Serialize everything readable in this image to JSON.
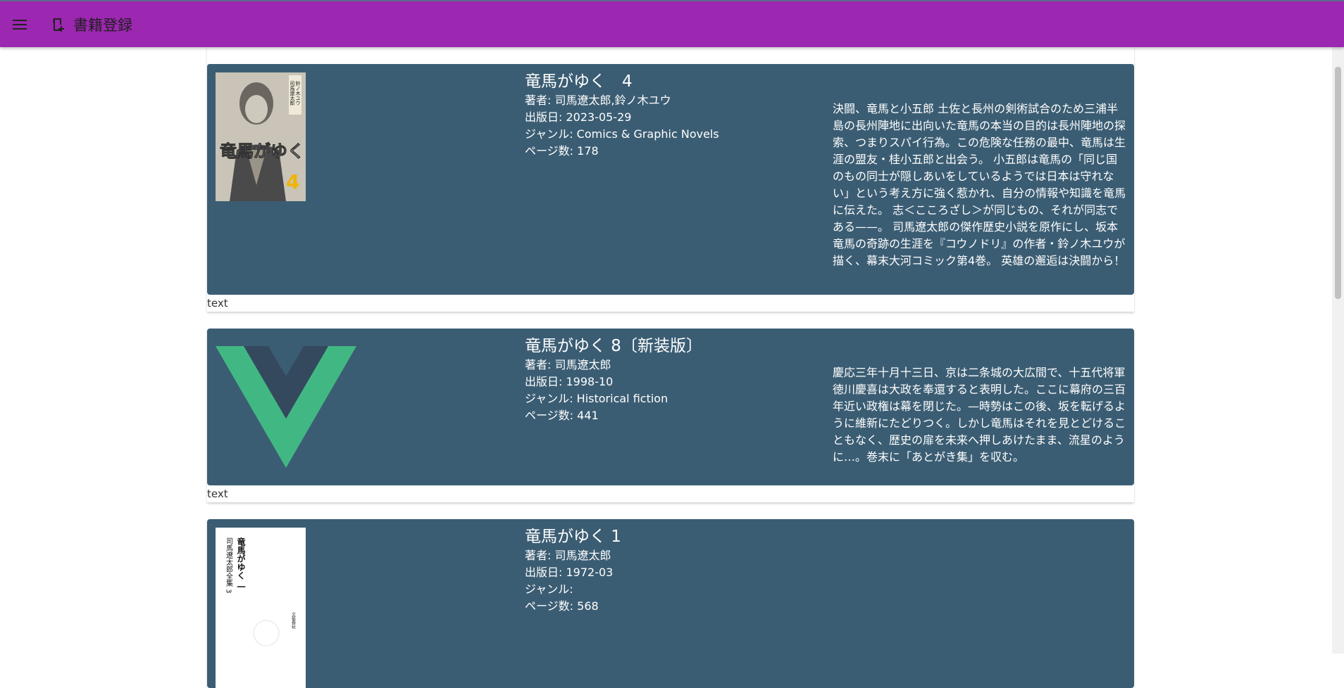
{
  "header": {
    "title": "書籍登録",
    "menu_icon": "hamburger-menu-icon",
    "brand_icon": "book-plus-icon",
    "background": "#9c27b0"
  },
  "books": [
    {
      "title": "竜馬がゆく　4",
      "author": "著者: 司馬遼太郎,鈴ノ木ユウ",
      "published": "出版日: 2023-05-29",
      "genre": "ジャンル: Comics & Graphic Novels",
      "pages": "ページ数: 178",
      "description": "決闘、竜馬と小五郎 土佐と長州の剣術試合のため三浦半島の長州陣地に出向いた竜馬の本当の目的は長州陣地の探索、つまりスパイ行為。この危険な任務の最中、竜馬は生涯の盟友・桂小五郎と出会う。 小五郎は竜馬の「同じ国のもの同士が隠しあいをしているようでは日本は守れない」という考え方に強く惹かれ、自分の情報や知識を竜馬に伝えた。 志＜こころざし＞が同じもの、それが同志である——。 司馬遼太郎の傑作歴史小説を原作にし、坂本竜馬の奇跡の生涯を『コウノドリ』の作者・鈴ノ木ユウが描く、幕末大河コミック第4巻。 英雄の邂逅は決闘から！",
      "cover_text": [
        "司馬遼太郎",
        "鈴ノ木ユウ",
        "竜馬がゆく",
        "4"
      ],
      "footer": "text"
    },
    {
      "title": "竜馬がゆく 8〔新装版〕",
      "author": "著者: 司馬遼太郎",
      "published": "出版日: 1998-10",
      "genre": "ジャンル: Historical fiction",
      "pages": "ページ数: 441",
      "description": "慶応三年十月十三日、京は二条城の大広間で、十五代将軍徳川慶喜は大政を奉還すると表明した。ここに幕府の三百年近い政権は幕を閉じた。—時勢はこの後、坂を転げるように維新にたどりつく。しかし竜馬はそれを見とどけることもなく、歴史の扉を未来へ押しあけたまま、流星のように…。巻末に「あとがき集」を収む。",
      "footer": "text"
    },
    {
      "title": "竜馬がゆく 1",
      "author": "著者: 司馬遼太郎",
      "published": "出版日: 1972-03",
      "genre": "ジャンル:",
      "pages": "ページ数: 568",
      "cover_text": [
        "竜馬がゆく 一",
        "司馬遼太郎全集 3",
        "文藝春秋"
      ]
    }
  ]
}
